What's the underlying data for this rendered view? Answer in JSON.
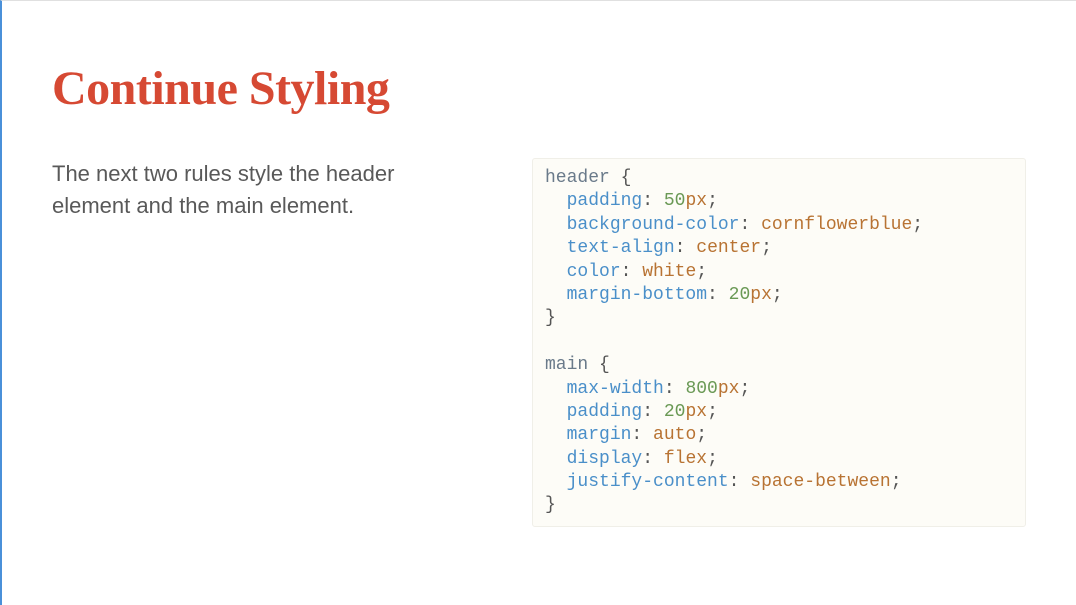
{
  "slide": {
    "title": "Continue Styling",
    "description": "The next two rules style the header element and the main element."
  },
  "code": {
    "rules": [
      {
        "selector": "header",
        "declarations": [
          {
            "property": "padding",
            "number": "50",
            "unit": "px"
          },
          {
            "property": "background-color",
            "value": "cornflowerblue"
          },
          {
            "property": "text-align",
            "value": "center"
          },
          {
            "property": "color",
            "value": "white"
          },
          {
            "property": "margin-bottom",
            "number": "20",
            "unit": "px"
          }
        ]
      },
      {
        "selector": "main",
        "declarations": [
          {
            "property": "max-width",
            "number": "800",
            "unit": "px"
          },
          {
            "property": "padding",
            "number": "20",
            "unit": "px"
          },
          {
            "property": "margin",
            "value": "auto"
          },
          {
            "property": "display",
            "value": "flex"
          },
          {
            "property": "justify-content",
            "value": "space-between"
          }
        ]
      }
    ]
  }
}
